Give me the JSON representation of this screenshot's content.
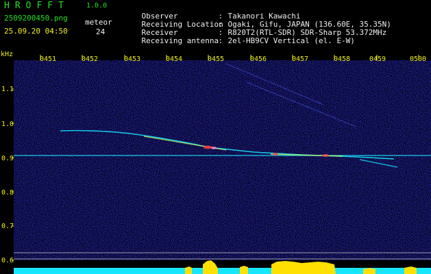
{
  "app": {
    "name": "HROFFT",
    "version": "1.0.0"
  },
  "file": {
    "name": "2509200450.png",
    "datetime": "25.09.20 04:50"
  },
  "meteor": {
    "label": "meteor",
    "count": "24"
  },
  "info": [
    {
      "label": "Observer",
      "sep": ":",
      "value": "Takanori Kawachi"
    },
    {
      "label": "Receiving Location",
      "sep": ":",
      "value": "Ogaki, Gifu, JAPAN (136.60E, 35.35N)"
    },
    {
      "label": "Receiver",
      "sep": ":",
      "value": "R820T2(RTL-SDR) SDR-Sharp 53.372MHz"
    },
    {
      "label": "Receiving antenna",
      "sep": ":",
      "value": "2el-HB9CV Vertical (el. E-W)"
    }
  ],
  "axis": {
    "unit": "kHz",
    "time_ticks": [
      "0451",
      "0452",
      "0453",
      "0454",
      "0455",
      "0456",
      "0457",
      "0458",
      "0459",
      "0500"
    ],
    "freq_ticks": [
      "1.1",
      "1.0",
      "0.9",
      "0.8",
      "0.7",
      "0.6"
    ]
  },
  "colors": {
    "background": "#000000",
    "label_green": "#1fe31f",
    "axis_yellow": "#f2f21a",
    "text_white": "#f0f0f0",
    "noise_blue": "#14148c",
    "signal_cyan": "#17e6ff",
    "burst_red": "#ff3a3a",
    "activity_yellow": "#ffe000"
  }
}
